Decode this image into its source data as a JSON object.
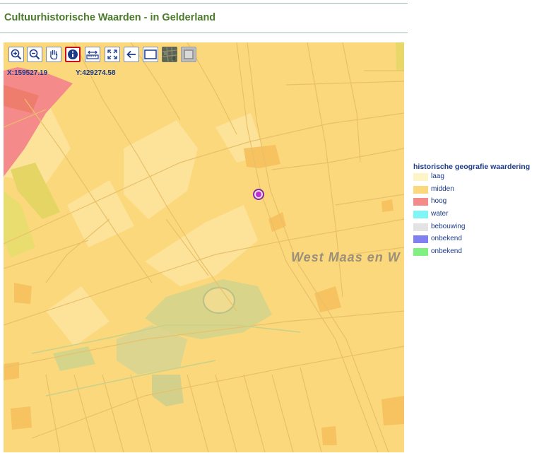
{
  "page": {
    "title": "Cultuurhistorische Waarden - in Gelderland"
  },
  "toolbar": {
    "tools": [
      {
        "name": "zoom-in",
        "icon": "zoom-in-icon"
      },
      {
        "name": "zoom-out",
        "icon": "zoom-out-icon"
      },
      {
        "name": "pan",
        "icon": "hand-icon"
      },
      {
        "name": "info",
        "icon": "info-icon",
        "active": true
      },
      {
        "name": "measure",
        "icon": "measure-icon"
      },
      {
        "name": "full-extent",
        "icon": "expand-icon"
      },
      {
        "name": "back",
        "icon": "arrow-left-icon"
      },
      {
        "name": "map-view",
        "icon": "map-view-icon"
      },
      {
        "name": "aerial-view",
        "icon": "aerial-photo-icon"
      },
      {
        "name": "layer-view",
        "icon": "layer-icon"
      }
    ]
  },
  "coordinates": {
    "x_text": "X:159527.19",
    "y_text": "Y:429274.58"
  },
  "map": {
    "place_label": "West Maas en W"
  },
  "legend": {
    "title": "historische geografie waardering",
    "items": [
      {
        "label": "laag",
        "color": "#fdf4c8"
      },
      {
        "label": "midden",
        "color": "#fbd87c"
      },
      {
        "label": "hoog",
        "color": "#f58a8a"
      },
      {
        "label": "water",
        "color": "#7ff5f5"
      },
      {
        "label": "bebouwing",
        "color": "#e3e3e3"
      },
      {
        "label": "onbekend",
        "color": "#8080f0"
      },
      {
        "label": "onbekend",
        "color": "#80f080"
      }
    ]
  }
}
